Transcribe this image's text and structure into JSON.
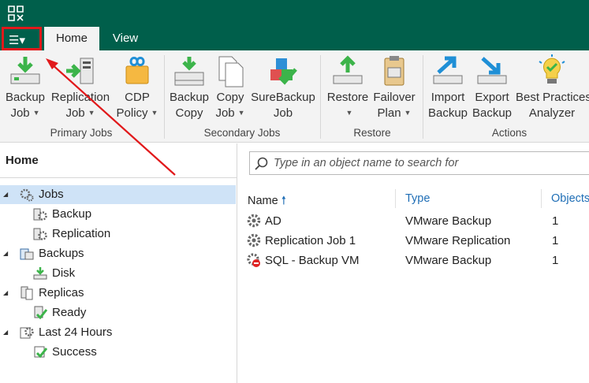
{
  "tabs": {
    "menu_label": "☰▾",
    "home": "Home",
    "view": "View"
  },
  "ribbon": {
    "groups": {
      "primary": "Primary Jobs",
      "secondary": "Secondary Jobs",
      "restore": "Restore",
      "actions": "Actions"
    },
    "buttons": {
      "backup_job": [
        "Backup",
        "Job"
      ],
      "replication_job": [
        "Replication",
        "Job"
      ],
      "cdp_policy": [
        "CDP",
        "Policy"
      ],
      "backup_copy": [
        "Backup",
        "Copy"
      ],
      "copy_job": [
        "Copy",
        "Job"
      ],
      "surebackup_job": [
        "SureBackup",
        "Job"
      ],
      "restore": [
        "Restore",
        ""
      ],
      "failover_plan": [
        "Failover",
        "Plan"
      ],
      "import_backup": [
        "Import",
        "Backup"
      ],
      "export_backup": [
        "Export",
        "Backup"
      ],
      "best_practices": [
        "Best Practices",
        "Analyzer"
      ]
    }
  },
  "left": {
    "title": "Home",
    "tree": {
      "jobs": "Jobs",
      "backup": "Backup",
      "replication": "Replication",
      "backups": "Backups",
      "disk": "Disk",
      "replicas": "Replicas",
      "ready": "Ready",
      "last24": "Last 24 Hours",
      "success": "Success"
    }
  },
  "search": {
    "placeholder": "Type in an object name to search for"
  },
  "table": {
    "headers": {
      "name": "Name",
      "type": "Type",
      "objects": "Objects"
    },
    "rows": [
      {
        "name": "AD",
        "type": "VMware Backup",
        "objects": "1"
      },
      {
        "name": "Replication Job 1",
        "type": "VMware Replication",
        "objects": "1"
      },
      {
        "name": "SQL - Backup VM",
        "type": "VMware Backup",
        "objects": "1"
      }
    ]
  },
  "colors": {
    "brand": "#005f4b",
    "accent_blue": "#1f6eb6",
    "highlight_red": "#e1191b",
    "selection": "#cfe3f7"
  }
}
